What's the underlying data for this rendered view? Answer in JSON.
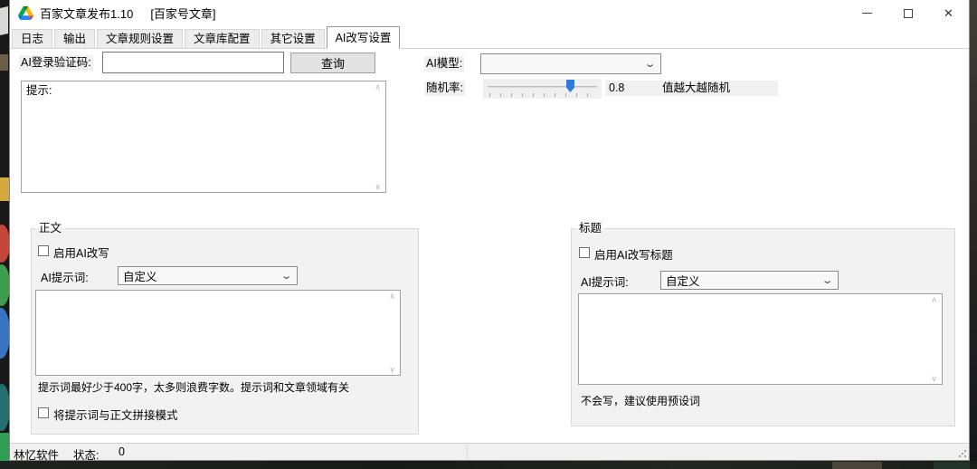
{
  "colors": {
    "accent_blue": "#2c7cd5",
    "window_bg": "#ffffff",
    "control_bg": "#f0f0f0",
    "group_bg": "#f2f2f2",
    "button_bg": "#e2e2e2",
    "desktop_bg": "#191919"
  },
  "window": {
    "title": "百家文章发布1.10",
    "subtitle": "[百家号文章]"
  },
  "tabs": [
    {
      "key": "log",
      "label": "日志",
      "active": false
    },
    {
      "key": "output",
      "label": "输出",
      "active": false
    },
    {
      "key": "article-rules",
      "label": "文章规则设置",
      "active": false
    },
    {
      "key": "article-library",
      "label": "文章库配置",
      "active": false
    },
    {
      "key": "other-settings",
      "label": "其它设置",
      "active": false
    },
    {
      "key": "ai-rewrite",
      "label": "AI改写设置",
      "active": true
    }
  ],
  "form": {
    "login_label": "AI登录验证码:",
    "login_value": "",
    "query_button": "查询",
    "log_text": "提示:",
    "model_label": "AI模型:",
    "model_value": "",
    "random_label": "随机率:",
    "random_value": "0.8",
    "random_hint": "值越大越随机",
    "random_fraction": 0.74
  },
  "body_group": {
    "title": "正文",
    "enable_label": "启用AI改写",
    "enable_checked": false,
    "prompt_label": "AI提示词:",
    "prompt_value": "自定义",
    "prompt_text": "",
    "hint": "提示词最好少于400字，太多则浪费字数。提示词和文章领域有关",
    "concat_label": "将提示词与正文拼接模式",
    "concat_checked": false
  },
  "title_group": {
    "title": "标题",
    "enable_label": "启用AI改写标题",
    "enable_checked": false,
    "prompt_label": "AI提示词:",
    "prompt_value": "自定义",
    "prompt_text": "",
    "hint": "不会写，建议使用预设词"
  },
  "statusbar": {
    "brand": "林忆软件",
    "status_label": "状态:",
    "status_value": "0"
  }
}
